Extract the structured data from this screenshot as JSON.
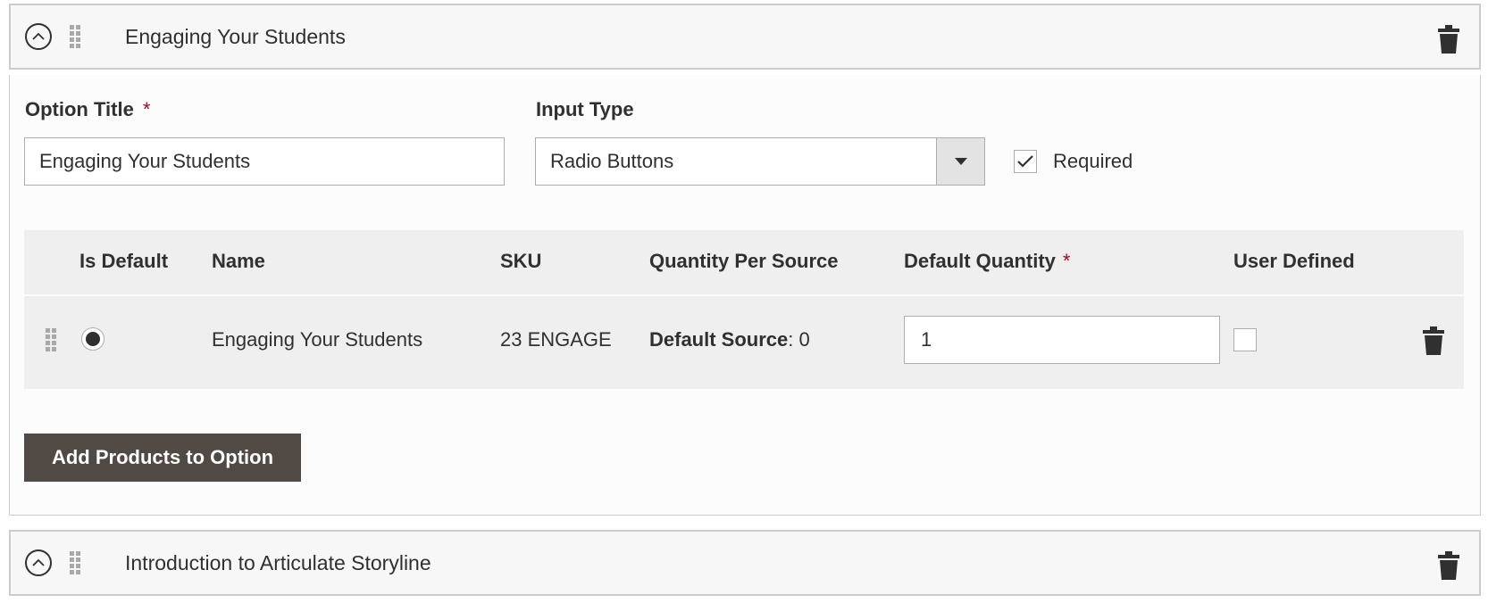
{
  "options": [
    {
      "title": "Engaging Your Students"
    },
    {
      "title": "Introduction to Articulate Storyline"
    }
  ],
  "form": {
    "option_title_label": "Option Title",
    "option_title_required": "*",
    "option_title_value": "Engaging Your Students",
    "input_type_label": "Input Type",
    "input_type_value": "Radio Buttons",
    "required_label": "Required",
    "required_checked": true
  },
  "grid": {
    "headers": {
      "is_default": "Is Default",
      "name": "Name",
      "sku": "SKU",
      "qty_per_source": "Quantity Per Source",
      "default_qty": "Default Quantity",
      "default_qty_required": "*",
      "user_defined": "User Defined"
    },
    "rows": [
      {
        "is_default": true,
        "name": "Engaging Your Students",
        "sku": "23 ENGAGE",
        "source_label": "Default Source",
        "source_value": ": 0",
        "default_qty": "1",
        "user_defined": false
      }
    ]
  },
  "add_button_label": "Add Products to Option",
  "colors": {
    "button_bg": "#514943",
    "required_star": "#b3001b",
    "grid_bg": "#efefef"
  },
  "icons": [
    "chevron-up-icon",
    "drag-handle-icon",
    "trash-icon",
    "chevron-down-icon",
    "checkmark-icon"
  ]
}
